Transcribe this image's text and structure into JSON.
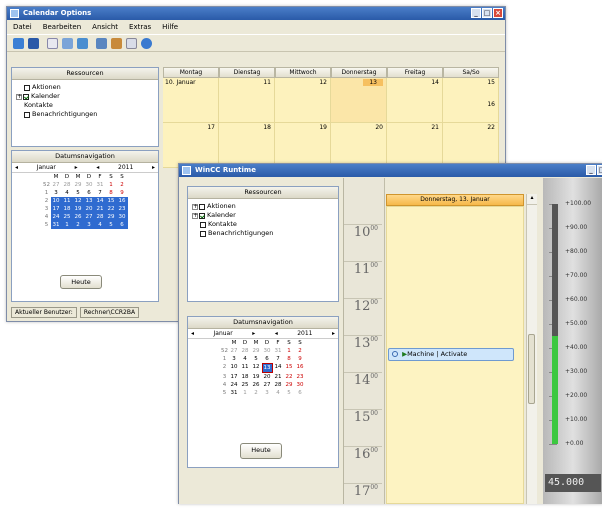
{
  "back_window": {
    "title": "Calendar Options",
    "menu": [
      "Datei",
      "Bearbeiten",
      "Ansicht",
      "Extras",
      "Hilfe"
    ],
    "toolbar_icons": [
      "new-icon",
      "save-icon",
      "refresh-icon",
      "edit-icon",
      "copy-icon",
      "grid-icon",
      "user-icon",
      "mail-icon",
      "globe-icon"
    ],
    "resources_title": "Ressourcen",
    "resources": [
      {
        "label": "Aktionen",
        "checked": false
      },
      {
        "label": "Kalender",
        "checked": true
      },
      {
        "label": "Kontakte",
        "checked": false
      },
      {
        "label": "Benachrichtigungen",
        "checked": false
      }
    ],
    "datenav_title": "Datumsnavigation",
    "month": "Januar",
    "year": "2011",
    "weekday_short": [
      "M",
      "D",
      "M",
      "D",
      "F",
      "S",
      "S"
    ],
    "weeks": [
      [
        "27",
        "28",
        "29",
        "30",
        "31",
        "1",
        "2"
      ],
      [
        "3",
        "4",
        "5",
        "6",
        "7",
        "8",
        "9"
      ],
      [
        "10",
        "11",
        "12",
        "13",
        "14",
        "15",
        "16"
      ],
      [
        "17",
        "18",
        "19",
        "20",
        "21",
        "22",
        "23"
      ],
      [
        "24",
        "25",
        "26",
        "27",
        "28",
        "29",
        "30"
      ],
      [
        "31",
        "1",
        "2",
        "3",
        "4",
        "5",
        "6"
      ]
    ],
    "week_numbers": [
      "52",
      "1",
      "2",
      "3",
      "4",
      "5"
    ],
    "heute_label": "Heute",
    "columns": [
      "Montag",
      "Dienstag",
      "Mittwoch",
      "Donnerstag",
      "Freitag",
      "Sa/So"
    ],
    "row1": [
      "10. Januar",
      "11",
      "12",
      "13",
      "14",
      "15"
    ],
    "row1_extra": "16",
    "row2": [
      "17",
      "18",
      "19",
      "20",
      "21",
      "22"
    ],
    "status": [
      "Aktueller Benutzer:",
      "Rechner\\CCR2BA"
    ]
  },
  "front_window": {
    "title": "WinCC Runtime",
    "resources_title": "Ressourcen",
    "resources": [
      {
        "label": "Aktionen",
        "checked": false
      },
      {
        "label": "Kalender",
        "checked": true
      },
      {
        "label": "Kontakte",
        "checked": false
      },
      {
        "label": "Benachrichtigungen",
        "checked": false
      }
    ],
    "datenav_title": "Datumsnavigation",
    "month": "Januar",
    "year": "2011",
    "weekday_short": [
      "M",
      "D",
      "M",
      "D",
      "F",
      "S",
      "S"
    ],
    "weeks": [
      [
        "27",
        "28",
        "29",
        "30",
        "31",
        "1",
        "2"
      ],
      [
        "3",
        "4",
        "5",
        "6",
        "7",
        "8",
        "9"
      ],
      [
        "10",
        "11",
        "12",
        "13",
        "14",
        "15",
        "16"
      ],
      [
        "17",
        "18",
        "19",
        "20",
        "21",
        "22",
        "23"
      ],
      [
        "24",
        "25",
        "26",
        "27",
        "28",
        "29",
        "30"
      ],
      [
        "31",
        "1",
        "2",
        "3",
        "4",
        "5",
        "6"
      ]
    ],
    "week_numbers": [
      "52",
      "1",
      "2",
      "3",
      "4",
      "5"
    ],
    "heute_label": "Heute",
    "day_header": "Donnerstag, 13. Januar",
    "hours": [
      "10",
      "11",
      "12",
      "13",
      "14",
      "15",
      "16",
      "17"
    ],
    "hour_suffix": "00",
    "event_label": "Machine | Activate",
    "gauge_labels": [
      "+100.00",
      "+90.00",
      "+80.00",
      "+70.00",
      "+60.00",
      "+50.00",
      "+40.00",
      "+30.00",
      "+20.00",
      "+10.00",
      "+0.00"
    ],
    "gauge_value": "45.000",
    "gauge_fill_fraction": 0.45,
    "colors": {
      "titlebar": "#2a5aa8",
      "calendar_cell": "#fdf2bd",
      "selection": "#2f6bd0",
      "gauge_fill": "#3cc840",
      "event": "#cfe6fb"
    }
  }
}
